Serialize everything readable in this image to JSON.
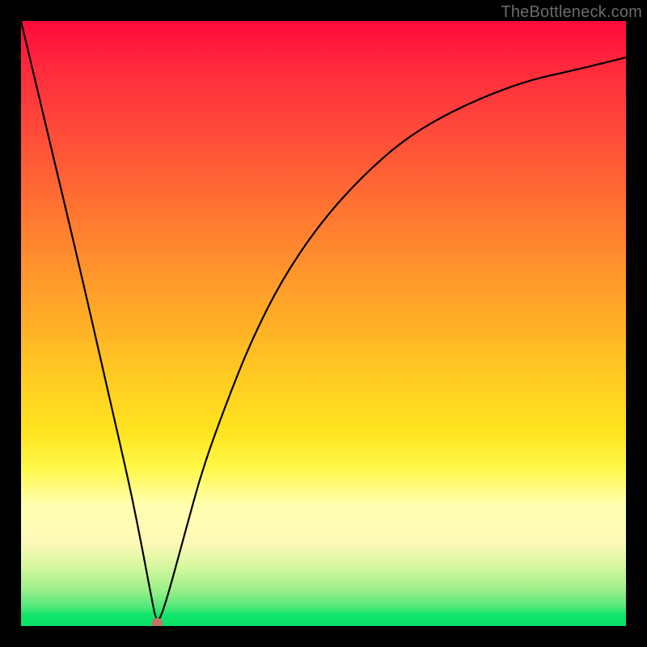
{
  "watermark": "TheBottleneck.com",
  "chart_data": {
    "type": "line",
    "title": "",
    "xlabel": "",
    "ylabel": "",
    "xlim": [
      0,
      100
    ],
    "ylim": [
      0,
      100
    ],
    "grid": false,
    "legend": false,
    "series": [
      {
        "name": "bottleneck-curve",
        "x": [
          0,
          5,
          10,
          15,
          18,
          20,
          21.5,
          22.5,
          24,
          27,
          30,
          34,
          38,
          43,
          49,
          56,
          64,
          73,
          83,
          92,
          100
        ],
        "y": [
          100,
          79,
          58,
          36,
          23,
          13,
          5,
          0,
          4,
          15,
          26,
          37,
          47,
          57,
          66,
          74,
          81,
          86,
          90,
          92,
          94
        ]
      }
    ],
    "marker": {
      "x": 22.5,
      "y": 0,
      "color": "#c27567"
    },
    "background_gradient": {
      "orientation": "vertical",
      "stops": [
        {
          "pos": 0.0,
          "color": "#ff0a3c"
        },
        {
          "pos": 0.38,
          "color": "#ff8a2e"
        },
        {
          "pos": 0.68,
          "color": "#ffe41f"
        },
        {
          "pos": 0.86,
          "color": "#fff9b8"
        },
        {
          "pos": 1.0,
          "color": "#06e466"
        }
      ]
    }
  }
}
